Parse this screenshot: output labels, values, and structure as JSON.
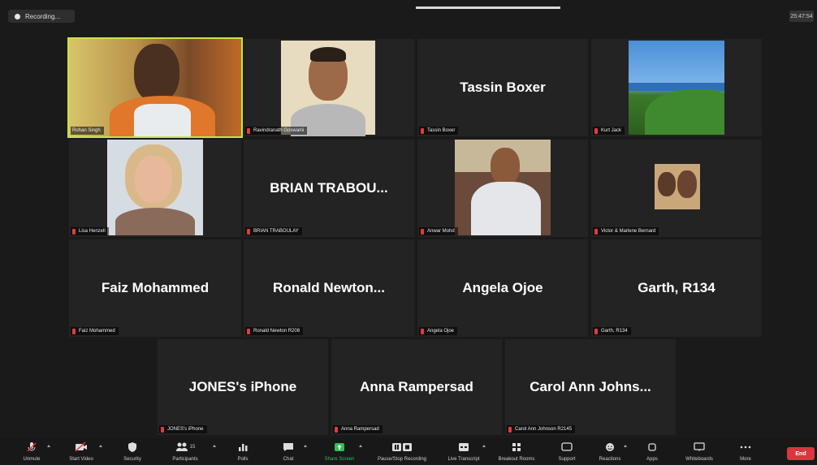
{
  "meeting": {
    "recording_label": "Recording...",
    "clock": "25:47:54"
  },
  "participants": [
    {
      "display": "",
      "name": "Rohan Singh"
    },
    {
      "display": "",
      "name": "Ravindranath Goswami"
    },
    {
      "display": "Tassin Boxer",
      "name": "Tassin Boxer"
    },
    {
      "display": "",
      "name": "Kurt Jack"
    },
    {
      "display": "",
      "name": "Lisa Henzell"
    },
    {
      "display": "BRIAN  TRABOU...",
      "name": "BRIAN TRABOULAY"
    },
    {
      "display": "",
      "name": "Anwar Mohd"
    },
    {
      "display": "",
      "name": "Victor & Marlene Bernard"
    },
    {
      "display": "Faiz Mohammed",
      "name": "Faiz Mohammed"
    },
    {
      "display": "Ronald  Newton...",
      "name": "Ronald Newton R208"
    },
    {
      "display": "Angela Ojoe",
      "name": "Angela Ojoe"
    },
    {
      "display": "Garth, R134",
      "name": "Garth, R134"
    },
    {
      "display": "JONES's iPhone",
      "name": "JONES's iPhone"
    },
    {
      "display": "Anna Rampersad",
      "name": "Anna Rampersad"
    },
    {
      "display": "Carol Ann Johns...",
      "name": "Carol Ann Johnson R2145"
    }
  ],
  "toolbar": {
    "unmute": "Unmute",
    "start_video": "Start Video",
    "security": "Security",
    "participants": "Participants",
    "participants_count": "15",
    "polls": "Polls",
    "chat": "Chat",
    "share_screen": "Share Screen",
    "pause_stop_recording": "Pause/Stop Recording",
    "live_transcript": "Live Transcript",
    "breakout_rooms": "Breakout Rooms",
    "support": "Support",
    "reactions": "Reactions",
    "apps": "Apps",
    "whiteboards": "Whiteboards",
    "more": "More",
    "end": "End"
  },
  "colors": {
    "active_speaker": "#c6e34a",
    "share_green": "#2fbf5a",
    "end_red": "#d9363e",
    "muted_red": "#e23b3b"
  }
}
